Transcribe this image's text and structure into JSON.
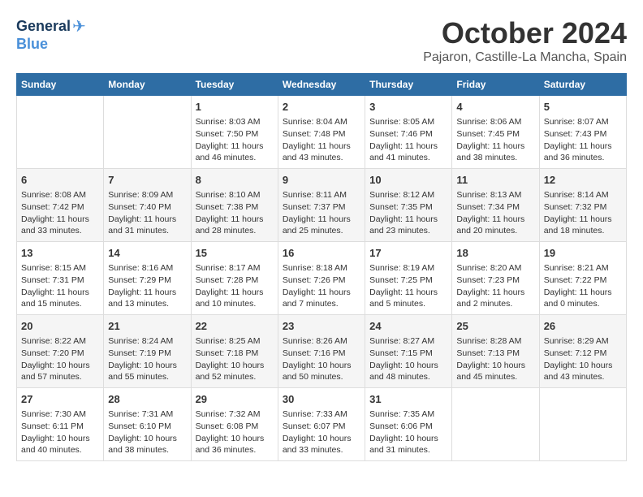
{
  "header": {
    "logo_line1": "General",
    "logo_line2": "Blue",
    "month": "October 2024",
    "location": "Pajaron, Castille-La Mancha, Spain"
  },
  "days_of_week": [
    "Sunday",
    "Monday",
    "Tuesday",
    "Wednesday",
    "Thursday",
    "Friday",
    "Saturday"
  ],
  "weeks": [
    [
      {
        "day": "",
        "info": ""
      },
      {
        "day": "",
        "info": ""
      },
      {
        "day": "1",
        "info": "Sunrise: 8:03 AM\nSunset: 7:50 PM\nDaylight: 11 hours\nand 46 minutes."
      },
      {
        "day": "2",
        "info": "Sunrise: 8:04 AM\nSunset: 7:48 PM\nDaylight: 11 hours\nand 43 minutes."
      },
      {
        "day": "3",
        "info": "Sunrise: 8:05 AM\nSunset: 7:46 PM\nDaylight: 11 hours\nand 41 minutes."
      },
      {
        "day": "4",
        "info": "Sunrise: 8:06 AM\nSunset: 7:45 PM\nDaylight: 11 hours\nand 38 minutes."
      },
      {
        "day": "5",
        "info": "Sunrise: 8:07 AM\nSunset: 7:43 PM\nDaylight: 11 hours\nand 36 minutes."
      }
    ],
    [
      {
        "day": "6",
        "info": "Sunrise: 8:08 AM\nSunset: 7:42 PM\nDaylight: 11 hours\nand 33 minutes."
      },
      {
        "day": "7",
        "info": "Sunrise: 8:09 AM\nSunset: 7:40 PM\nDaylight: 11 hours\nand 31 minutes."
      },
      {
        "day": "8",
        "info": "Sunrise: 8:10 AM\nSunset: 7:38 PM\nDaylight: 11 hours\nand 28 minutes."
      },
      {
        "day": "9",
        "info": "Sunrise: 8:11 AM\nSunset: 7:37 PM\nDaylight: 11 hours\nand 25 minutes."
      },
      {
        "day": "10",
        "info": "Sunrise: 8:12 AM\nSunset: 7:35 PM\nDaylight: 11 hours\nand 23 minutes."
      },
      {
        "day": "11",
        "info": "Sunrise: 8:13 AM\nSunset: 7:34 PM\nDaylight: 11 hours\nand 20 minutes."
      },
      {
        "day": "12",
        "info": "Sunrise: 8:14 AM\nSunset: 7:32 PM\nDaylight: 11 hours\nand 18 minutes."
      }
    ],
    [
      {
        "day": "13",
        "info": "Sunrise: 8:15 AM\nSunset: 7:31 PM\nDaylight: 11 hours\nand 15 minutes."
      },
      {
        "day": "14",
        "info": "Sunrise: 8:16 AM\nSunset: 7:29 PM\nDaylight: 11 hours\nand 13 minutes."
      },
      {
        "day": "15",
        "info": "Sunrise: 8:17 AM\nSunset: 7:28 PM\nDaylight: 11 hours\nand 10 minutes."
      },
      {
        "day": "16",
        "info": "Sunrise: 8:18 AM\nSunset: 7:26 PM\nDaylight: 11 hours\nand 7 minutes."
      },
      {
        "day": "17",
        "info": "Sunrise: 8:19 AM\nSunset: 7:25 PM\nDaylight: 11 hours\nand 5 minutes."
      },
      {
        "day": "18",
        "info": "Sunrise: 8:20 AM\nSunset: 7:23 PM\nDaylight: 11 hours\nand 2 minutes."
      },
      {
        "day": "19",
        "info": "Sunrise: 8:21 AM\nSunset: 7:22 PM\nDaylight: 11 hours\nand 0 minutes."
      }
    ],
    [
      {
        "day": "20",
        "info": "Sunrise: 8:22 AM\nSunset: 7:20 PM\nDaylight: 10 hours\nand 57 minutes."
      },
      {
        "day": "21",
        "info": "Sunrise: 8:24 AM\nSunset: 7:19 PM\nDaylight: 10 hours\nand 55 minutes."
      },
      {
        "day": "22",
        "info": "Sunrise: 8:25 AM\nSunset: 7:18 PM\nDaylight: 10 hours\nand 52 minutes."
      },
      {
        "day": "23",
        "info": "Sunrise: 8:26 AM\nSunset: 7:16 PM\nDaylight: 10 hours\nand 50 minutes."
      },
      {
        "day": "24",
        "info": "Sunrise: 8:27 AM\nSunset: 7:15 PM\nDaylight: 10 hours\nand 48 minutes."
      },
      {
        "day": "25",
        "info": "Sunrise: 8:28 AM\nSunset: 7:13 PM\nDaylight: 10 hours\nand 45 minutes."
      },
      {
        "day": "26",
        "info": "Sunrise: 8:29 AM\nSunset: 7:12 PM\nDaylight: 10 hours\nand 43 minutes."
      }
    ],
    [
      {
        "day": "27",
        "info": "Sunrise: 7:30 AM\nSunset: 6:11 PM\nDaylight: 10 hours\nand 40 minutes."
      },
      {
        "day": "28",
        "info": "Sunrise: 7:31 AM\nSunset: 6:10 PM\nDaylight: 10 hours\nand 38 minutes."
      },
      {
        "day": "29",
        "info": "Sunrise: 7:32 AM\nSunset: 6:08 PM\nDaylight: 10 hours\nand 36 minutes."
      },
      {
        "day": "30",
        "info": "Sunrise: 7:33 AM\nSunset: 6:07 PM\nDaylight: 10 hours\nand 33 minutes."
      },
      {
        "day": "31",
        "info": "Sunrise: 7:35 AM\nSunset: 6:06 PM\nDaylight: 10 hours\nand 31 minutes."
      },
      {
        "day": "",
        "info": ""
      },
      {
        "day": "",
        "info": ""
      }
    ]
  ]
}
